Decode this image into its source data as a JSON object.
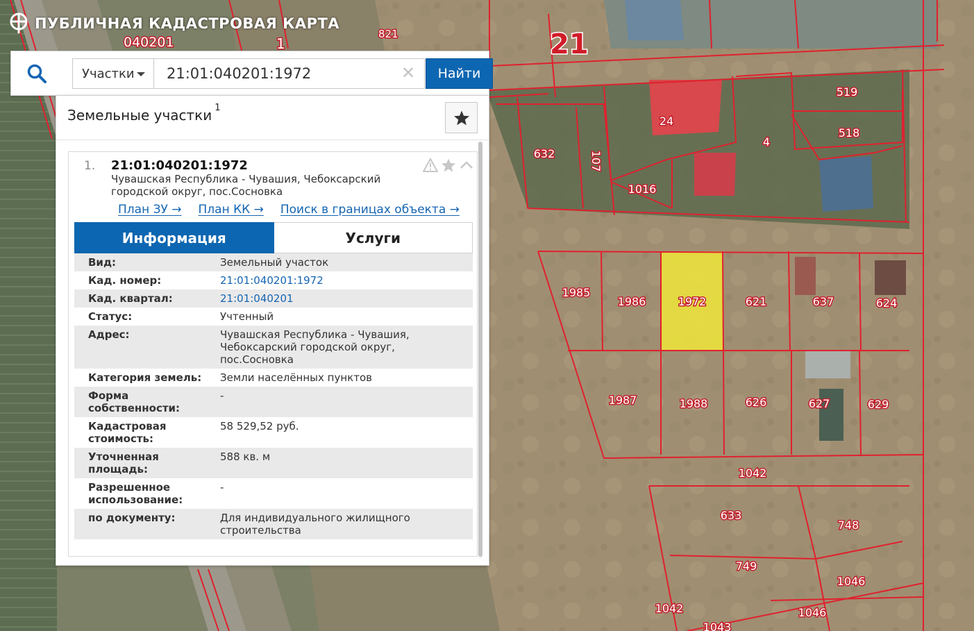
{
  "app": {
    "title": "ПУБЛИЧНАЯ КАДАСТРОВАЯ КАРТА"
  },
  "search": {
    "type_selected": "Участки",
    "value": "21:01:040201:1972",
    "button_label": "Найти"
  },
  "results": {
    "title": "Земельные участки",
    "count": "1",
    "items": [
      {
        "number": "1.",
        "cadastral_number": "21:01:040201:1972",
        "address": "Чувашская Республика - Чувашия, Чебоксарский городской округ, пос.Сосновка",
        "links": [
          "План ЗУ →",
          "План КК →",
          "Поиск в границах объекта →"
        ],
        "tabs": [
          "Информация",
          "Услуги"
        ],
        "info": [
          {
            "key": "Вид:",
            "value": "Земельный участок"
          },
          {
            "key": "Кад. номер:",
            "value": "21:01:040201:1972"
          },
          {
            "key": "Кад. квартал:",
            "value": "21:01:040201"
          },
          {
            "key": "Статус:",
            "value": "Учтенный"
          },
          {
            "key": "Адрес:",
            "value": "Чувашская Республика - Чувашия, Чебоксарский городской округ, пос.Сосновка"
          },
          {
            "key": "Категория земель:",
            "value": "Земли населённых пунктов"
          },
          {
            "key": "Форма собственности:",
            "value": "-"
          },
          {
            "key": "Кадастровая стоимость:",
            "value": "58 529,52 руб."
          },
          {
            "key": "Уточненная площадь:",
            "value": "588 кв. м"
          },
          {
            "key": "Разрешенное использование:",
            "value": "-"
          },
          {
            "key": "по документу:",
            "value": "Для индивидуального жилищного строительства"
          }
        ]
      }
    ]
  },
  "map": {
    "quarter_label": "040201",
    "region_label": "21",
    "small_labels": [
      "1",
      "821"
    ],
    "parcel_labels": [
      "519",
      "518",
      "24",
      "4",
      "632",
      "107",
      "1016",
      "1985",
      "1986",
      "1972",
      "621",
      "637",
      "624",
      "1987",
      "1988",
      "626",
      "627",
      "629",
      "1042",
      "633",
      "748",
      "749",
      "1046",
      "1042",
      "1046",
      "1043"
    ],
    "highlight_color": "#f0e63a",
    "boundary_color": "#e0212e"
  }
}
